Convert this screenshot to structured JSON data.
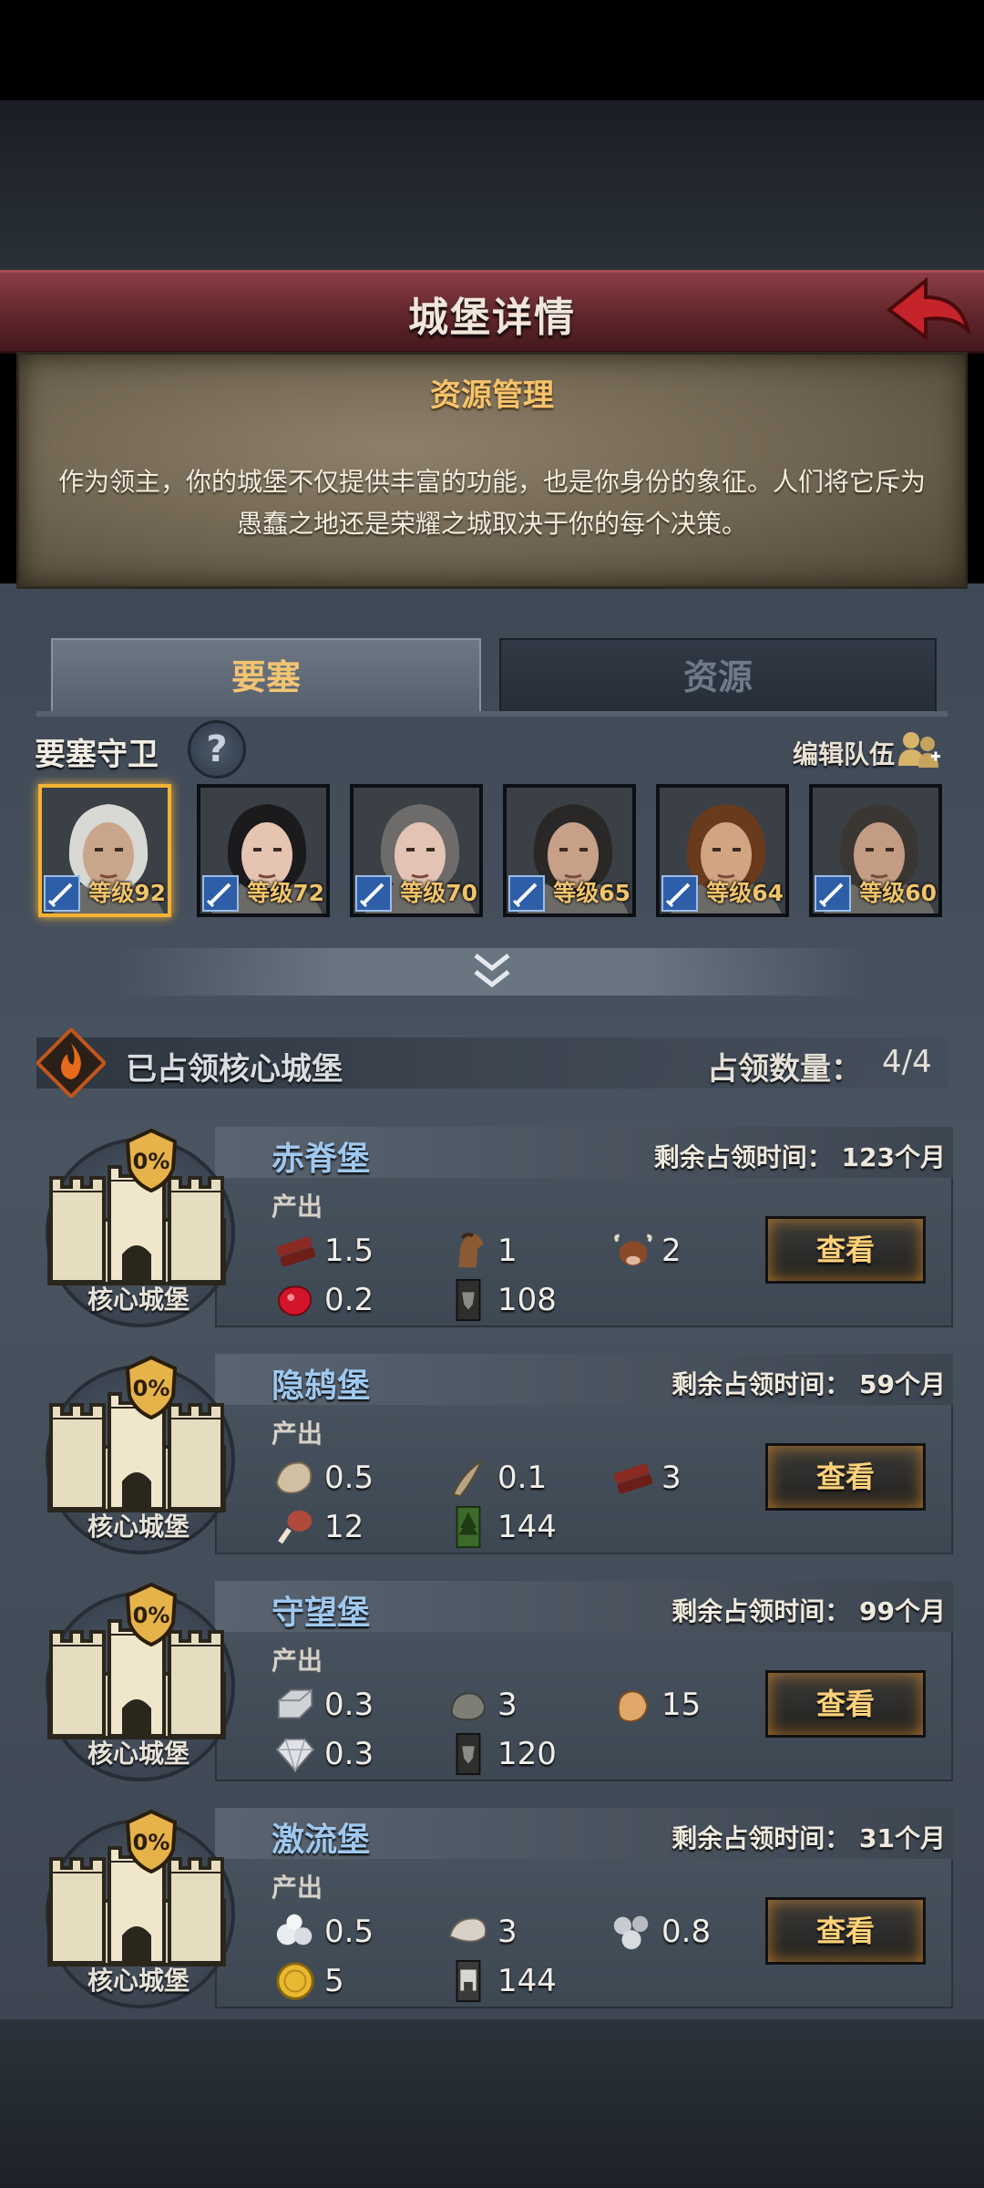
{
  "header": {
    "title": "城堡详情"
  },
  "intro": {
    "title": "资源管理",
    "description": "作为领主，你的城堡不仅提供丰富的功能，也是你身份的象征。人们将它斥为愚蠢之地还是荣耀之城取决于你的每个决策。"
  },
  "tabs": [
    {
      "label": "要塞",
      "active": true
    },
    {
      "label": "资源",
      "active": false
    }
  ],
  "guards": {
    "title": "要塞守卫",
    "help_icon": "?",
    "edit_label": "编辑队伍",
    "heroes": [
      {
        "level": "等级92",
        "selected": true,
        "hair": "#d8d8d4",
        "skin": "#c9a58a"
      },
      {
        "level": "等级72",
        "selected": false,
        "hair": "#1b1a1c",
        "skin": "#e6c4b2"
      },
      {
        "level": "等级70",
        "selected": false,
        "hair": "#6e6c6a",
        "skin": "#e2c3b4"
      },
      {
        "level": "等级65",
        "selected": false,
        "hair": "#2a2826",
        "skin": "#c7a088"
      },
      {
        "level": "等级64",
        "selected": false,
        "hair": "#6a3a1c",
        "skin": "#d1a582"
      },
      {
        "level": "等级60",
        "selected": false,
        "hair": "#3a3632",
        "skin": "#c39c84"
      }
    ]
  },
  "core": {
    "title": "已占领核心城堡",
    "occupy_label": "占领数量：",
    "occupy_count": "4/4"
  },
  "castles": [
    {
      "name": "赤脊堡",
      "badge": "0%",
      "core_label": "核心城堡",
      "remain": "剩余占领时间： 123个月",
      "output_label": "产出",
      "button": "查看",
      "resources": [
        {
          "icon": "wood-icon",
          "value": "1.5"
        },
        {
          "icon": "horse-icon",
          "value": "1"
        },
        {
          "icon": "cattle-icon",
          "value": "2"
        },
        {
          "icon": "ruby-icon",
          "value": "0.2"
        },
        {
          "icon": "banner-icon",
          "value": "108"
        }
      ]
    },
    {
      "name": "隐鸫堡",
      "badge": "0%",
      "core_label": "核心城堡",
      "remain": "剩余占领时间： 59个月",
      "output_label": "产出",
      "button": "查看",
      "resources": [
        {
          "icon": "fur-icon",
          "value": "0.5"
        },
        {
          "icon": "horn-icon",
          "value": "0.1"
        },
        {
          "icon": "wood-icon",
          "value": "3"
        },
        {
          "icon": "meat-icon",
          "value": "12"
        },
        {
          "icon": "tree-banner-icon",
          "value": "144"
        }
      ]
    },
    {
      "name": "守望堡",
      "badge": "0%",
      "core_label": "核心城堡",
      "remain": "剩余占领时间： 99个月",
      "output_label": "产出",
      "button": "查看",
      "resources": [
        {
          "icon": "iron-icon",
          "value": "0.3"
        },
        {
          "icon": "stone-icon",
          "value": "3"
        },
        {
          "icon": "ore-icon",
          "value": "15"
        },
        {
          "icon": "diamond-icon",
          "value": "0.3"
        },
        {
          "icon": "banner-icon",
          "value": "120"
        }
      ]
    },
    {
      "name": "激流堡",
      "badge": "0%",
      "core_label": "核心城堡",
      "remain": "剩余占领时间： 31个月",
      "output_label": "产出",
      "button": "查看",
      "resources": [
        {
          "icon": "pearl-icon",
          "value": "0.5"
        },
        {
          "icon": "oyster-icon",
          "value": "3"
        },
        {
          "icon": "silver-pearl-icon",
          "value": "0.8"
        },
        {
          "icon": "gold-coin-icon",
          "value": "5"
        },
        {
          "icon": "castle-banner-icon",
          "value": "144"
        }
      ]
    }
  ],
  "colors": {
    "title_bar": "#5c2429",
    "accent_gold": "#f2b233",
    "castle_name": "#9fc8ee",
    "button_text": "#ffd27a"
  }
}
